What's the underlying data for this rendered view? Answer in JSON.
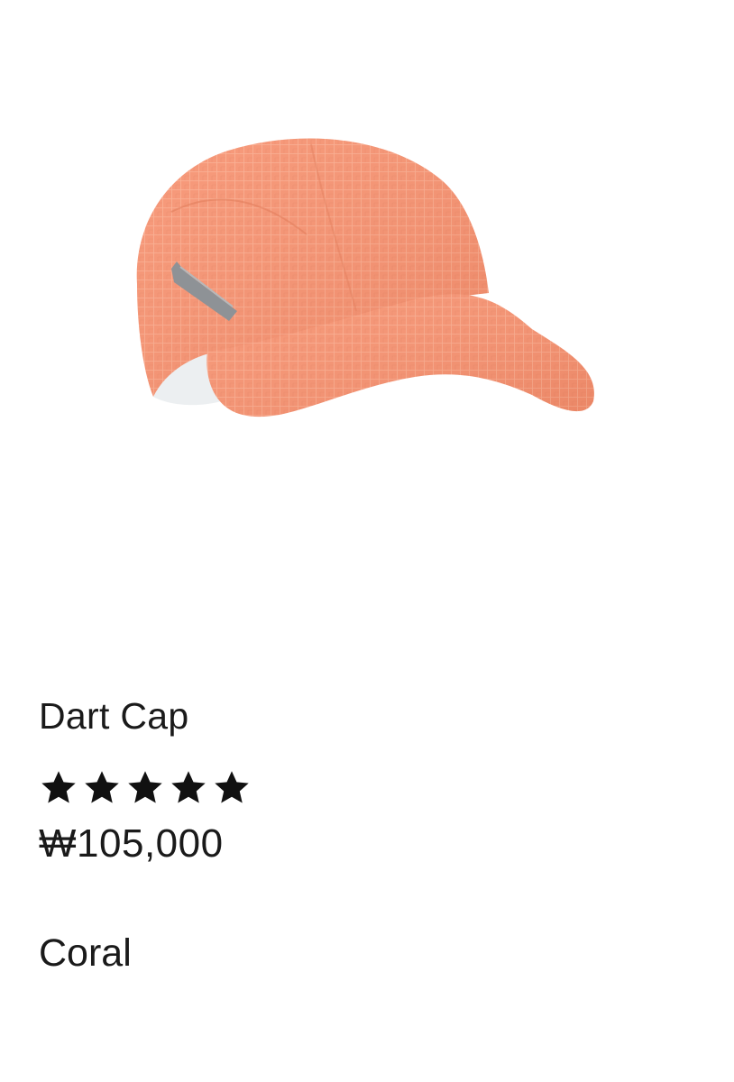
{
  "product": {
    "name": "Dart Cap",
    "rating": 5,
    "rating_max": 5,
    "price": "₩105,000",
    "color_name": "Coral",
    "image_icon": "cap-product-image",
    "accent_color": "#F6916F"
  }
}
